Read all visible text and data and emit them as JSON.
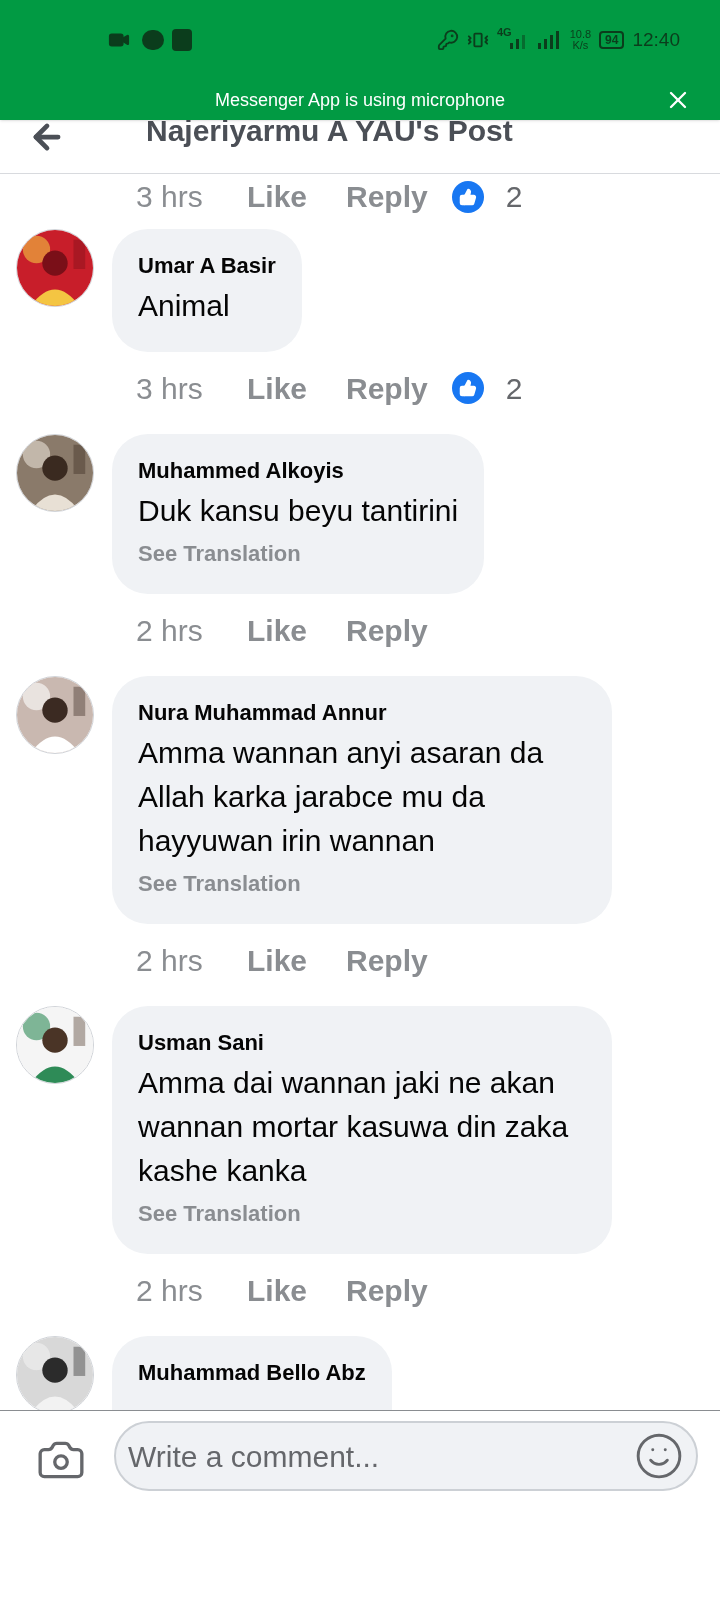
{
  "status_bar": {
    "network": "4G",
    "speed_value": "10.8",
    "speed_unit": "K/s",
    "battery": "94",
    "time": "12:40"
  },
  "banner": {
    "text": "Messenger App is using microphone"
  },
  "header": {
    "title": "Najeriyarmu A YAU's Post"
  },
  "top_actions": {
    "time": "3 hrs",
    "like": "Like",
    "reply": "Reply",
    "reaction_count": "2"
  },
  "comments": [
    {
      "name": "Umar A Basir",
      "text": "Animal",
      "actions": {
        "time": "3 hrs",
        "like": "Like",
        "reply": "Reply",
        "reaction_count": "2"
      }
    },
    {
      "name": "Muhammed Alkoyis",
      "text": "Duk kansu beyu tantirini",
      "translation": "See Translation",
      "actions": {
        "time": "2 hrs",
        "like": "Like",
        "reply": "Reply"
      }
    },
    {
      "name": "Nura Muhammad Annur",
      "text": "Amma wannan anyi asaran da Allah karka jarabce mu da hayyuwan irin wannan",
      "translation": "See Translation",
      "actions": {
        "time": "2 hrs",
        "like": "Like",
        "reply": "Reply"
      }
    },
    {
      "name": "Usman Sani",
      "text": "Amma dai wannan jaki ne akan wannan mortar kasuwa din zaka kashe kanka",
      "translation": "See Translation",
      "actions": {
        "time": "2 hrs",
        "like": "Like",
        "reply": "Reply"
      }
    },
    {
      "name": "Muhammad Bello Abz"
    }
  ],
  "composer": {
    "placeholder": "Write a comment..."
  }
}
